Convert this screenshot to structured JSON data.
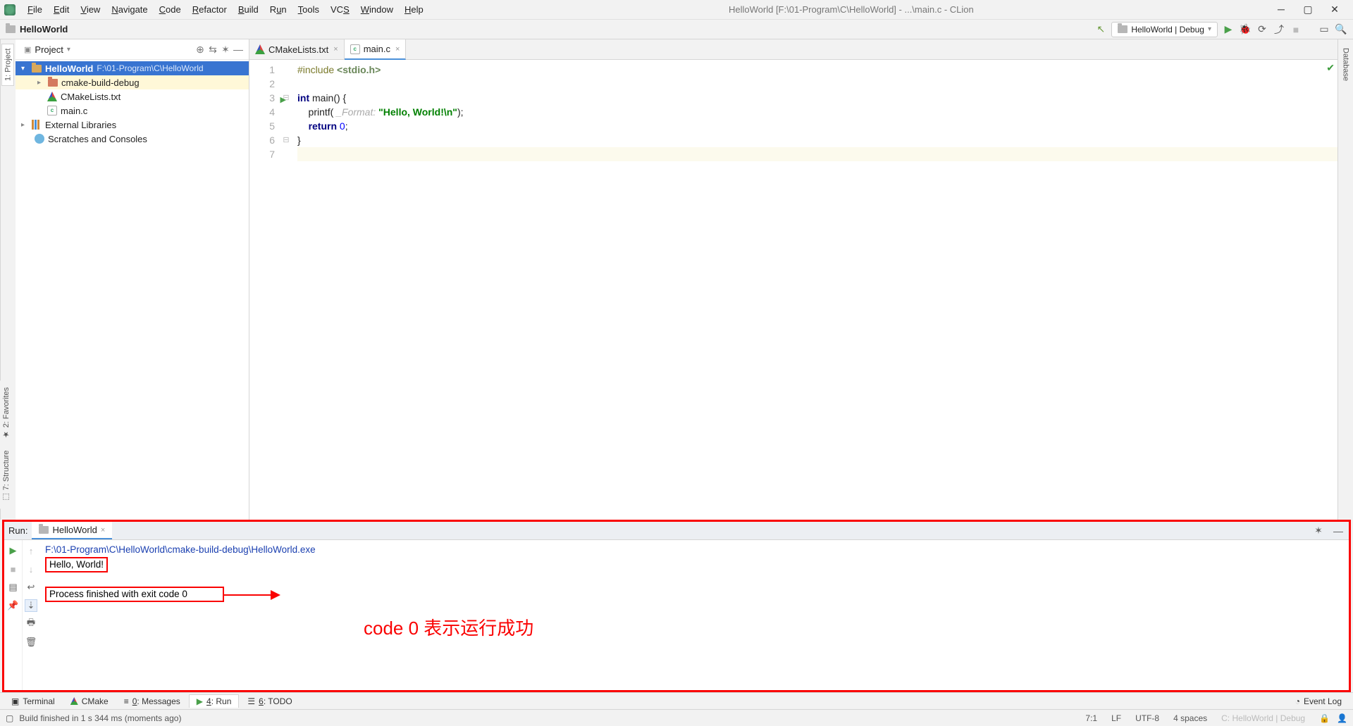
{
  "window": {
    "title": "HelloWorld [F:\\01-Program\\C\\HelloWorld] - ...\\main.c - CLion"
  },
  "menu": {
    "file": "File",
    "edit": "Edit",
    "view": "View",
    "navigate": "Navigate",
    "code": "Code",
    "refactor": "Refactor",
    "build": "Build",
    "run": "Run",
    "tools": "Tools",
    "vcs": "VCS",
    "window": "Window",
    "help": "Help"
  },
  "breadcrumb": {
    "project": "HelloWorld"
  },
  "toolbar_right": {
    "run_config": "HelloWorld | Debug"
  },
  "project_panel": {
    "title": "Project",
    "root_name": "HelloWorld",
    "root_path": "F:\\01-Program\\C\\HelloWorld",
    "items": [
      {
        "name": "cmake-build-debug"
      },
      {
        "name": "CMakeLists.txt"
      },
      {
        "name": "main.c"
      }
    ],
    "external": "External Libraries",
    "scratches": "Scratches and Consoles"
  },
  "left_tabs": {
    "project": "1: Project"
  },
  "left_tabs2": {
    "favorites": "2: Favorites",
    "structure": "7: Structure"
  },
  "right_tabs": {
    "database": "Database"
  },
  "editor": {
    "tabs": [
      {
        "label": "CMakeLists.txt"
      },
      {
        "label": "main.c"
      }
    ],
    "lines": {
      "l1a": "#include ",
      "l1b": "<stdio.h>",
      "l3a": "int",
      "l3b": " main() {",
      "l4a": "    printf( ",
      "l4h": "_Format: ",
      "l4s": "\"Hello, World!\\n\"",
      "l4b": ");",
      "l5a": "    ",
      "l5b": "return ",
      "l5c": "0",
      "l5d": ";",
      "l6": "}"
    },
    "line_numbers": [
      "1",
      "2",
      "3",
      "4",
      "5",
      "6",
      "7"
    ]
  },
  "run_panel": {
    "label": "Run:",
    "tab": "HelloWorld",
    "console": {
      "path": "F:\\01-Program\\C\\HelloWorld\\cmake-build-debug\\HelloWorld.exe",
      "out1": "Hello, World!",
      "out2": "Process finished with exit code 0"
    },
    "annotation": "code 0 表示运行成功"
  },
  "bottom_tabs": {
    "terminal": "Terminal",
    "cmake": "CMake",
    "messages": "0: Messages",
    "run": "4: Run",
    "todo": "6: TODO",
    "eventlog": "Event Log"
  },
  "status": {
    "msg": "Build finished in 1 s 344 ms (moments ago)",
    "pos": "7:1",
    "eol": "LF",
    "enc": "UTF-8",
    "indent": "4 spaces",
    "context": "C: HelloWorld | Debug"
  }
}
